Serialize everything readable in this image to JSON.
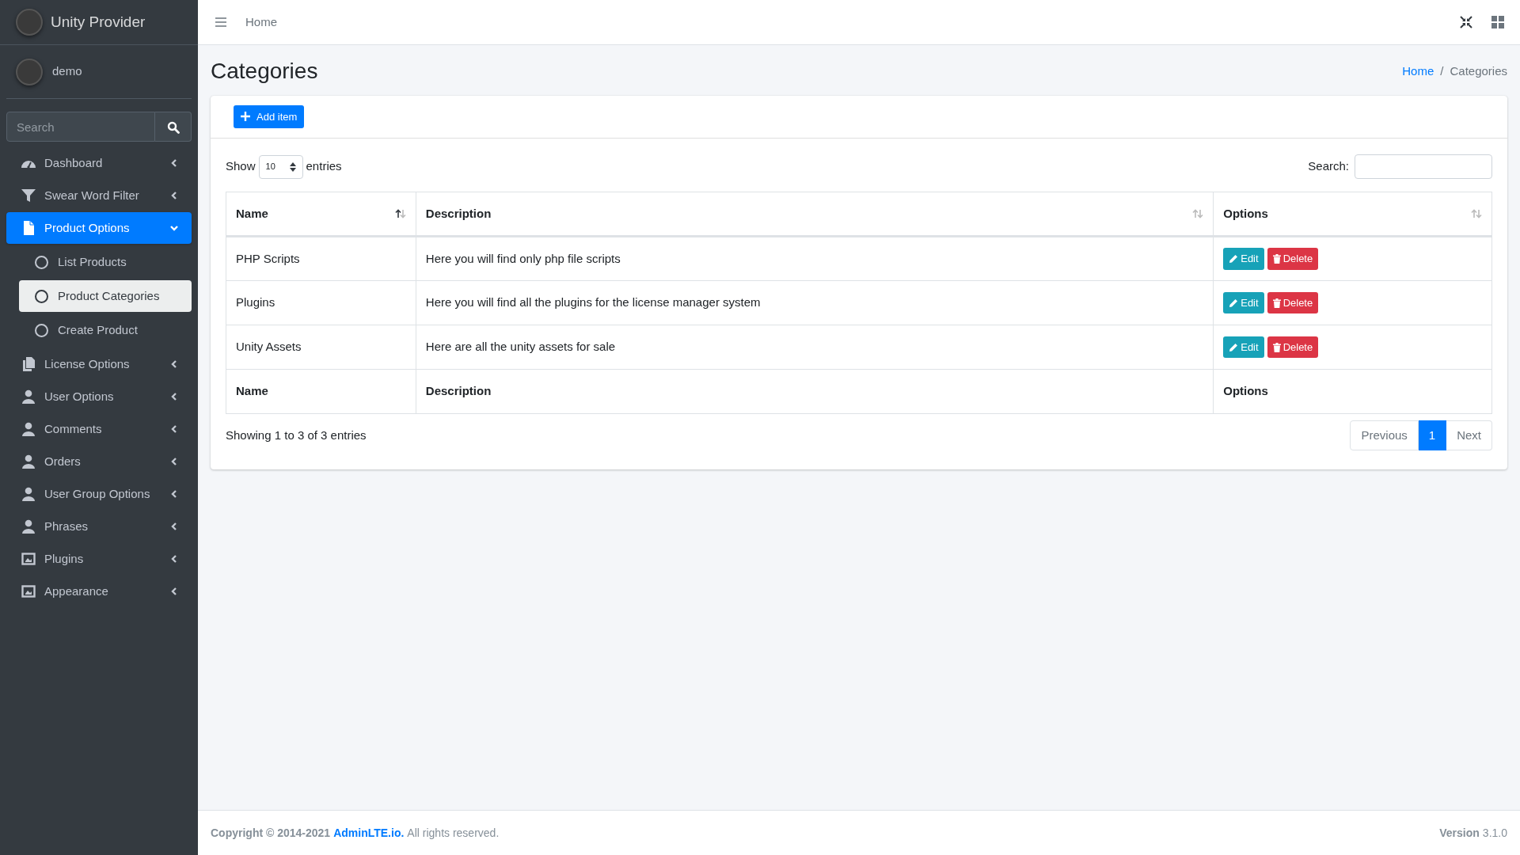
{
  "brand": {
    "name": "Unity Provider"
  },
  "user": {
    "name": "demo"
  },
  "sidebar_search": {
    "placeholder": "Search"
  },
  "nav": [
    {
      "label": "Dashboard",
      "kind": "dashboard",
      "selected": false,
      "expanded": false
    },
    {
      "label": "Swear Word Filter",
      "kind": "filter",
      "selected": false,
      "expanded": false
    },
    {
      "label": "Product Options",
      "kind": "file",
      "selected": true,
      "expanded": true,
      "children": [
        {
          "label": "List Products",
          "selected": false
        },
        {
          "label": "Product Categories",
          "selected": true
        },
        {
          "label": "Create Product",
          "selected": false
        }
      ]
    },
    {
      "label": "License Options",
      "kind": "copy",
      "selected": false,
      "expanded": false
    },
    {
      "label": "User Options",
      "kind": "user",
      "selected": false,
      "expanded": false
    },
    {
      "label": "Comments",
      "kind": "user",
      "selected": false,
      "expanded": false
    },
    {
      "label": "Orders",
      "kind": "user",
      "selected": false,
      "expanded": false
    },
    {
      "label": "User Group Options",
      "kind": "user",
      "selected": false,
      "expanded": false
    },
    {
      "label": "Phrases",
      "kind": "user",
      "selected": false,
      "expanded": false
    },
    {
      "label": "Plugins",
      "kind": "frame",
      "selected": false,
      "expanded": false
    },
    {
      "label": "Appearance",
      "kind": "frame",
      "selected": false,
      "expanded": false
    }
  ],
  "topbar": {
    "links": [
      "Home"
    ]
  },
  "page": {
    "title": "Categories",
    "breadcrumb": [
      {
        "label": "Home",
        "kind": "link"
      },
      {
        "label": "/",
        "kind": "separator"
      },
      {
        "label": "Categories",
        "kind": "current"
      }
    ]
  },
  "card": {
    "add_button": "Add item",
    "length": {
      "before": "Show",
      "value": "10",
      "after": "entries"
    },
    "search": {
      "label": "Search:"
    },
    "columns": [
      {
        "label": "Name",
        "kind": "asc"
      },
      {
        "label": "Description",
        "kind": "both"
      },
      {
        "label": "Options",
        "kind": "both"
      }
    ],
    "rows": [
      {
        "name": "PHP Scripts",
        "description": "Here you will find only php file scripts",
        "actions": [
          {
            "label": "Edit",
            "kind": "edit"
          },
          {
            "label": "Delete",
            "kind": "delete"
          }
        ]
      },
      {
        "name": "Plugins",
        "description": "Here you will find all the plugins for the license manager system",
        "actions": [
          {
            "label": "Edit",
            "kind": "edit"
          },
          {
            "label": "Delete",
            "kind": "delete"
          }
        ]
      },
      {
        "name": "Unity Assets",
        "description": "Here are all the unity assets for sale",
        "actions": [
          {
            "label": "Edit",
            "kind": "edit"
          },
          {
            "label": "Delete",
            "kind": "delete"
          }
        ]
      }
    ],
    "footer_columns": [
      "Name",
      "Description",
      "Options"
    ],
    "info": "Showing 1 to 3 of 3 entries",
    "pagination": [
      {
        "label": "Previous",
        "selected": false,
        "disabled": true
      },
      {
        "label": "1",
        "selected": true,
        "disabled": false
      },
      {
        "label": "Next",
        "selected": false,
        "disabled": true
      }
    ]
  },
  "footer": {
    "copyright": "Copyright © 2014-2021",
    "link": "AdminLTE.io.",
    "rights": "All rights reserved.",
    "version_label": "Version",
    "version": "3.1.0"
  }
}
